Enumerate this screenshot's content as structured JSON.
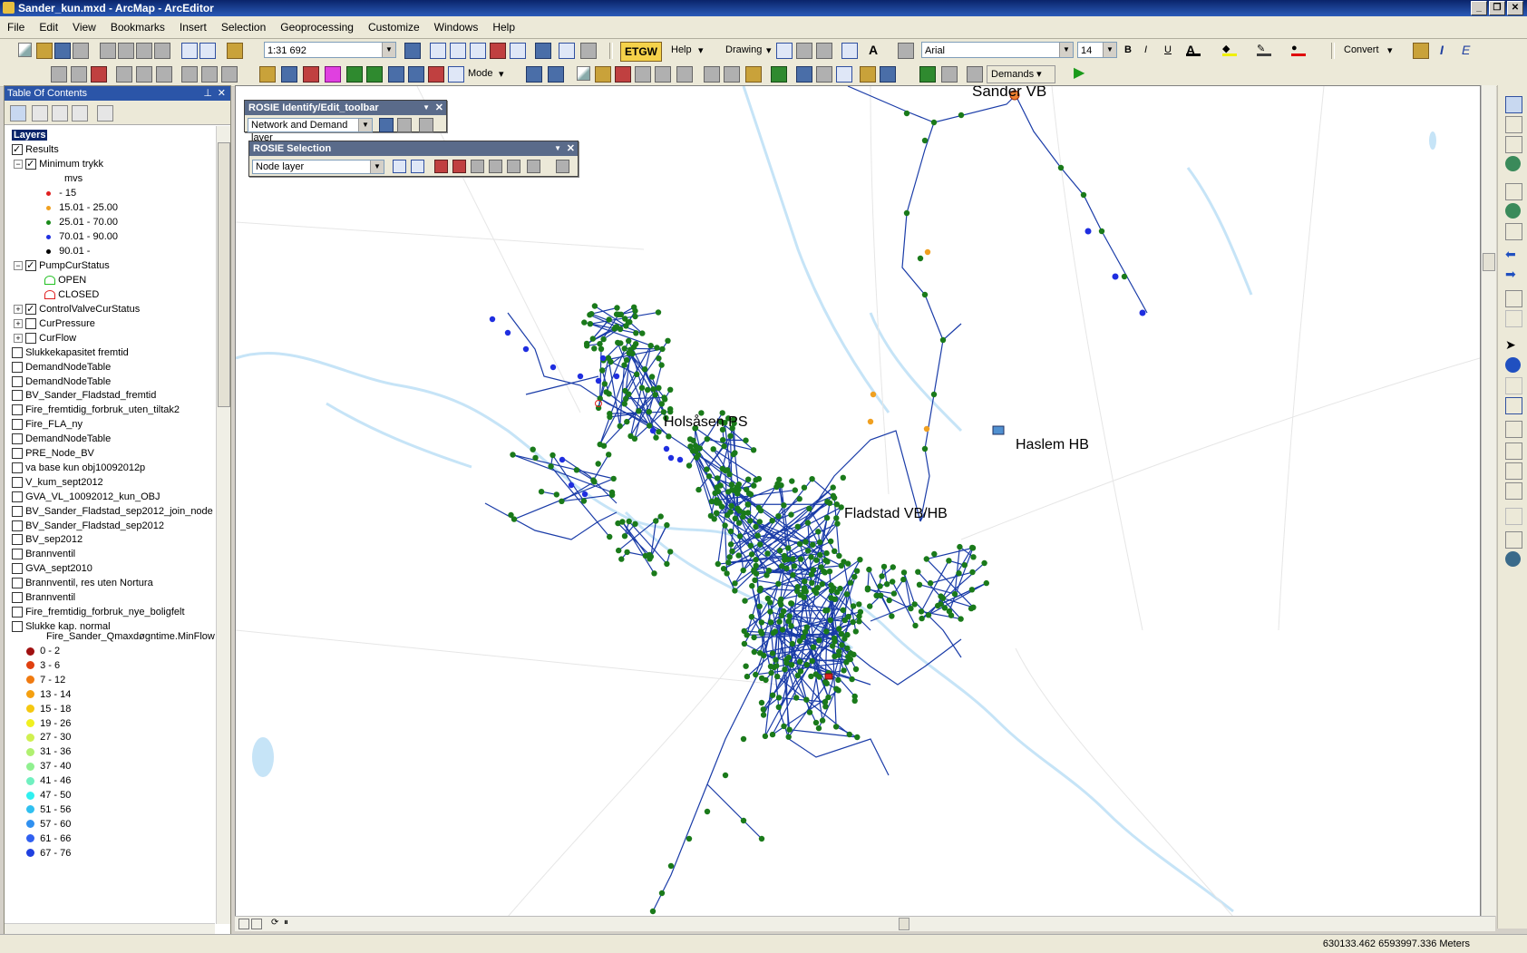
{
  "window": {
    "title": "Sander_kun.mxd - ArcMap - ArcEditor"
  },
  "menu": [
    "File",
    "Edit",
    "View",
    "Bookmarks",
    "Insert",
    "Selection",
    "Geoprocessing",
    "Customize",
    "Windows",
    "Help"
  ],
  "toolbar": {
    "scale": "1:31 692",
    "help_label": "Help",
    "drawing_label": "Drawing",
    "font_name": "Arial",
    "font_size": "14",
    "bold": "B",
    "italic": "I",
    "underline": "U",
    "convert_label": "Convert",
    "mode_label": "Mode",
    "demands_label": "Demands",
    "etgw_label": "ETGW"
  },
  "toc": {
    "title": "Table Of Contents",
    "layers_label": "Layers",
    "results_label": "Results",
    "min_trykk": {
      "label": "Minimum trykk",
      "unit": "mvs",
      "classes": [
        {
          "label": "- 15",
          "color": "#e02020"
        },
        {
          "label": "15.01 - 25.00",
          "color": "#f0a020"
        },
        {
          "label": "25.01 - 70.00",
          "color": "#1a8a1a"
        },
        {
          "label": "70.01 - 90.00",
          "color": "#2030e0"
        },
        {
          "label": "90.01 -",
          "color": "#000000"
        }
      ]
    },
    "pump": {
      "label": "PumpCurStatus",
      "open": "OPEN",
      "closed": "CLOSED"
    },
    "layers": [
      {
        "label": "ControlValveCurStatus",
        "checked": true,
        "expand": true
      },
      {
        "label": "CurPressure",
        "checked": false,
        "expand": true
      },
      {
        "label": "CurFlow",
        "checked": false,
        "expand": true
      },
      {
        "label": "Slukkekapasitet fremtid",
        "checked": false
      },
      {
        "label": "DemandNodeTable",
        "checked": false
      },
      {
        "label": "DemandNodeTable",
        "checked": false
      },
      {
        "label": "BV_Sander_Fladstad_fremtid",
        "checked": false
      },
      {
        "label": "Fire_fremtidig_forbruk_uten_tiltak2",
        "checked": false
      },
      {
        "label": "Fire_FLA_ny",
        "checked": false
      },
      {
        "label": "DemandNodeTable",
        "checked": false
      },
      {
        "label": "PRE_Node_BV",
        "checked": false
      },
      {
        "label": "va base kun obj10092012p",
        "checked": false
      },
      {
        "label": "V_kum_sept2012",
        "checked": false
      },
      {
        "label": "GVA_VL_10092012_kun_OBJ",
        "checked": false
      },
      {
        "label": "BV_Sander_Fladstad_sep2012_join_node",
        "checked": false
      },
      {
        "label": "BV_Sander_Fladstad_sep2012",
        "checked": false
      },
      {
        "label": "BV_sep2012",
        "checked": false
      },
      {
        "label": "Brannventil",
        "checked": false
      },
      {
        "label": "GVA_sept2010",
        "checked": false
      },
      {
        "label": "Brannventil, res uten Nortura",
        "checked": false
      },
      {
        "label": "Brannventil",
        "checked": false
      },
      {
        "label": "Fire_fremtidig_forbruk_nye_boligfelt",
        "checked": false
      },
      {
        "label": "Slukke kap. normal",
        "checked": false
      }
    ],
    "flow_field": "Fire_Sander_Qmaxdøgntime.MinFlowC",
    "flow_classes": [
      {
        "label": "0 - 2",
        "color": "#a01010"
      },
      {
        "label": "3 - 6",
        "color": "#e04010"
      },
      {
        "label": "7 - 12",
        "color": "#f07a10"
      },
      {
        "label": "13 - 14",
        "color": "#f5a010"
      },
      {
        "label": "15 - 18",
        "color": "#f5c810"
      },
      {
        "label": "19 - 26",
        "color": "#f0f020"
      },
      {
        "label": "27 - 30",
        "color": "#d0f050"
      },
      {
        "label": "31 - 36",
        "color": "#b0f070"
      },
      {
        "label": "37 - 40",
        "color": "#90f090"
      },
      {
        "label": "41 - 46",
        "color": "#70f0c0"
      },
      {
        "label": "47 - 50",
        "color": "#30f0f0"
      },
      {
        "label": "51 - 56",
        "color": "#30c0f0"
      },
      {
        "label": "57 - 60",
        "color": "#3090f0"
      },
      {
        "label": "61 - 66",
        "color": "#3060f0"
      },
      {
        "label": "67 - 76",
        "color": "#2040e0"
      }
    ]
  },
  "rosie_identify": {
    "title": "ROSIE Identify/Edit_toolbar",
    "layer": "Network and Demand layer"
  },
  "rosie_selection": {
    "title": "ROSIE Selection",
    "layer": "Node layer"
  },
  "map": {
    "labels": {
      "sander_vb": "Sander VB",
      "haslem_hb": "Haslem HB",
      "holsasen_ps": "Holsåsen PS",
      "fladstad": "Fladstad VB/HB"
    }
  },
  "status": {
    "coords": "630133.462  6593997.336 Meters"
  }
}
